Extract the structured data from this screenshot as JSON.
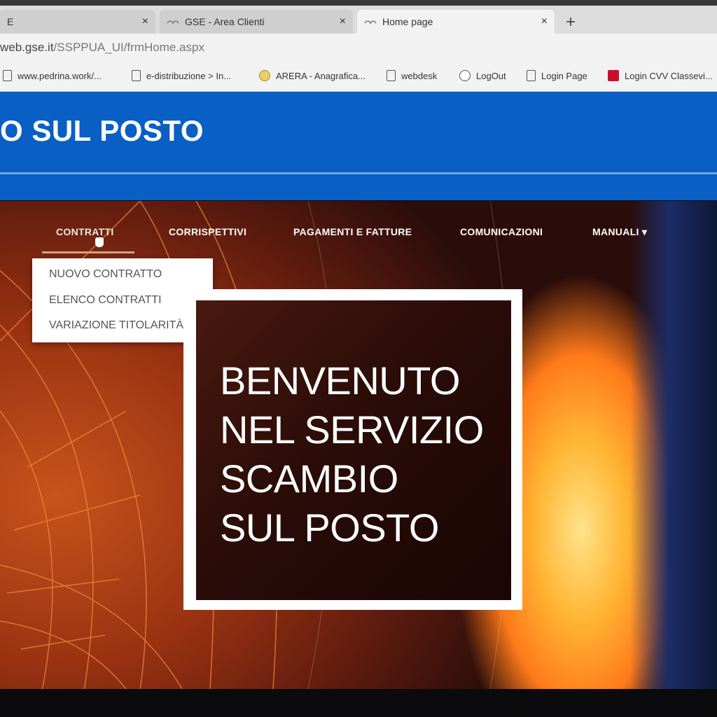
{
  "browser": {
    "tabs": [
      {
        "title": "E",
        "active": false
      },
      {
        "title": "GSE - Area Clienti",
        "active": false
      },
      {
        "title": "Home page",
        "active": true
      }
    ],
    "tab_close": "×",
    "new_tab": "+",
    "url_host": "web.gse.it",
    "url_path": "/SSPPUA_UI/frmHome.aspx",
    "bookmarks": [
      {
        "label": "www.pedrina.work/...",
        "icon": "page-icon"
      },
      {
        "label": "e-distribuzione > In...",
        "icon": "page-icon"
      },
      {
        "label": "ARERA - Anagrafica...",
        "icon": "arera-icon"
      },
      {
        "label": "webdesk",
        "icon": "page-icon"
      },
      {
        "label": "LogOut",
        "icon": "logout-icon"
      },
      {
        "label": "Login Page",
        "icon": "page-icon"
      },
      {
        "label": "Login CVV Classevi...",
        "icon": "classeviva-icon"
      }
    ]
  },
  "site": {
    "title": "O SUL POSTO",
    "header_color": "#0a5fc4"
  },
  "menu": {
    "items": [
      {
        "label": "CONTRATTI"
      },
      {
        "label": "CORRISPETTIVI"
      },
      {
        "label": "PAGAMENTI E FATTURE"
      },
      {
        "label": "COMUNICAZIONI"
      },
      {
        "label": "MANUALI ▾"
      }
    ],
    "dropdown": [
      {
        "label": "NUOVO CONTRATTO"
      },
      {
        "label": "ELENCO CONTRATTI"
      },
      {
        "label": "VARIAZIONE TITOLARITÀ"
      }
    ]
  },
  "hero": {
    "lines": [
      "BENVENUTO",
      "NEL SERVIZIO",
      "SCAMBIO",
      "SUL POSTO"
    ]
  }
}
